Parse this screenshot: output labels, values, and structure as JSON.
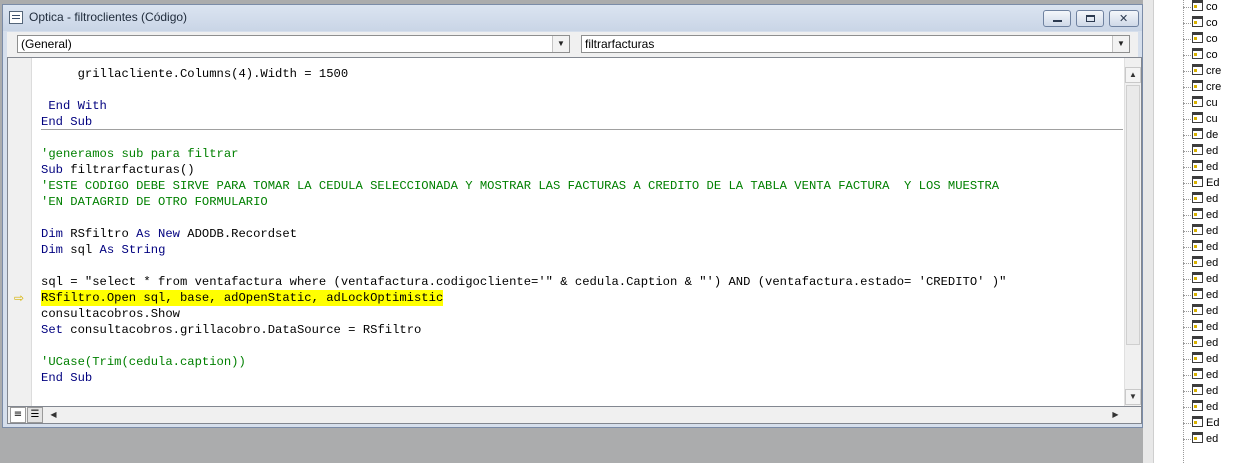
{
  "window": {
    "title": "Optica - filtroclientes (Código)"
  },
  "combos": {
    "object": "(General)",
    "procedure": "filtrarfacturas"
  },
  "code": {
    "lines": [
      "grillacliente.Columns(4).Width = 1500",
      "",
      "End With",
      "End Sub",
      "",
      "'generamos sub para filtrar",
      "filtrarfacturas()",
      "'ESTE CODIGO DEBE SIRVE PARA TOMAR LA CEDULA SELECCIONADA Y MOSTRAR LAS FACTURAS A CREDITO DE LA TABLA VENTA FACTURA  Y LOS MUESTRA",
      "'EN DATAGRID DE OTRO FORMULARIO",
      "",
      " RSfiltro ",
      " ADODB.Recordset",
      " sql ",
      "",
      "sql = \"select * from ventafactura where (ventafactura.codigocliente='\" & cedula.Caption & \"') AND (ventafactura.estado= 'CREDITO' )\"",
      "RSfiltro.Open sql, base, adOpenStatic, adLockOptimistic",
      "consultacobros.Show",
      " consultacobros.grillacobro.DataSource = RSfiltro",
      "",
      "'UCase(Trim(cedula.caption))",
      "End Sub"
    ],
    "kw": {
      "end_with": "End With",
      "end_sub": "End Sub",
      "sub": "Sub",
      "dim": "Dim",
      "as_new": "As New",
      "as": "As",
      "string": "String",
      "set": "Set"
    },
    "wrapper_indent": "     "
  },
  "project_tree": {
    "items": [
      "co",
      "co",
      "co",
      "co",
      "cre",
      "cre",
      "cu",
      "cu",
      "de",
      "ed",
      "ed",
      "Ed",
      "ed",
      "ed",
      "ed",
      "ed",
      "ed",
      "ed",
      "ed",
      "ed",
      "ed",
      "ed",
      "ed",
      "ed",
      "ed",
      "ed",
      "Ed",
      "ed"
    ]
  },
  "colors": {
    "keyword": "#00007f",
    "comment": "#008000",
    "highlight": "#ffff00"
  }
}
